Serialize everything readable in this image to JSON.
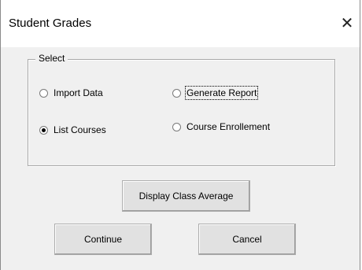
{
  "window": {
    "title": "Student Grades",
    "close_glyph": "✕"
  },
  "select_group": {
    "legend": "Select",
    "options": [
      {
        "label": "Import Data",
        "checked": false
      },
      {
        "label": "Generate Report",
        "checked": false,
        "focused": true
      },
      {
        "label": "List Courses",
        "checked": true
      },
      {
        "label": "Course Enrollement",
        "checked": false
      }
    ]
  },
  "buttons": {
    "display_class_average": "Display Class Average",
    "continue": "Continue",
    "cancel": "Cancel"
  }
}
